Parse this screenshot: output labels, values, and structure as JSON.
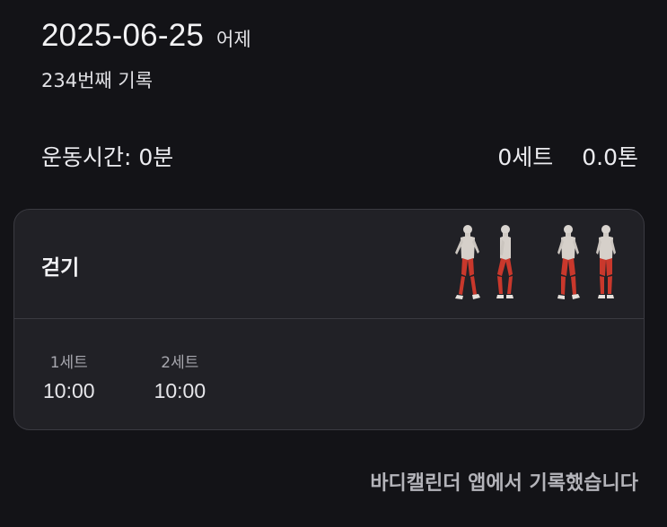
{
  "header": {
    "date": "2025-06-25",
    "relative_day": "어제",
    "record_count": "234번째 기록"
  },
  "summary": {
    "duration": "운동시간: 0분",
    "sets": "0세트",
    "volume": "0.0톤"
  },
  "exercise": {
    "name": "걷기",
    "illustration_icon": "walking-figures-icon",
    "muscle_highlight_color": "#c9382c",
    "sets": [
      {
        "label": "1세트",
        "time": "10:00"
      },
      {
        "label": "2세트",
        "time": "10:00"
      }
    ]
  },
  "footer": {
    "source_note": "바디캘린더 앱에서 기록했습니다"
  }
}
